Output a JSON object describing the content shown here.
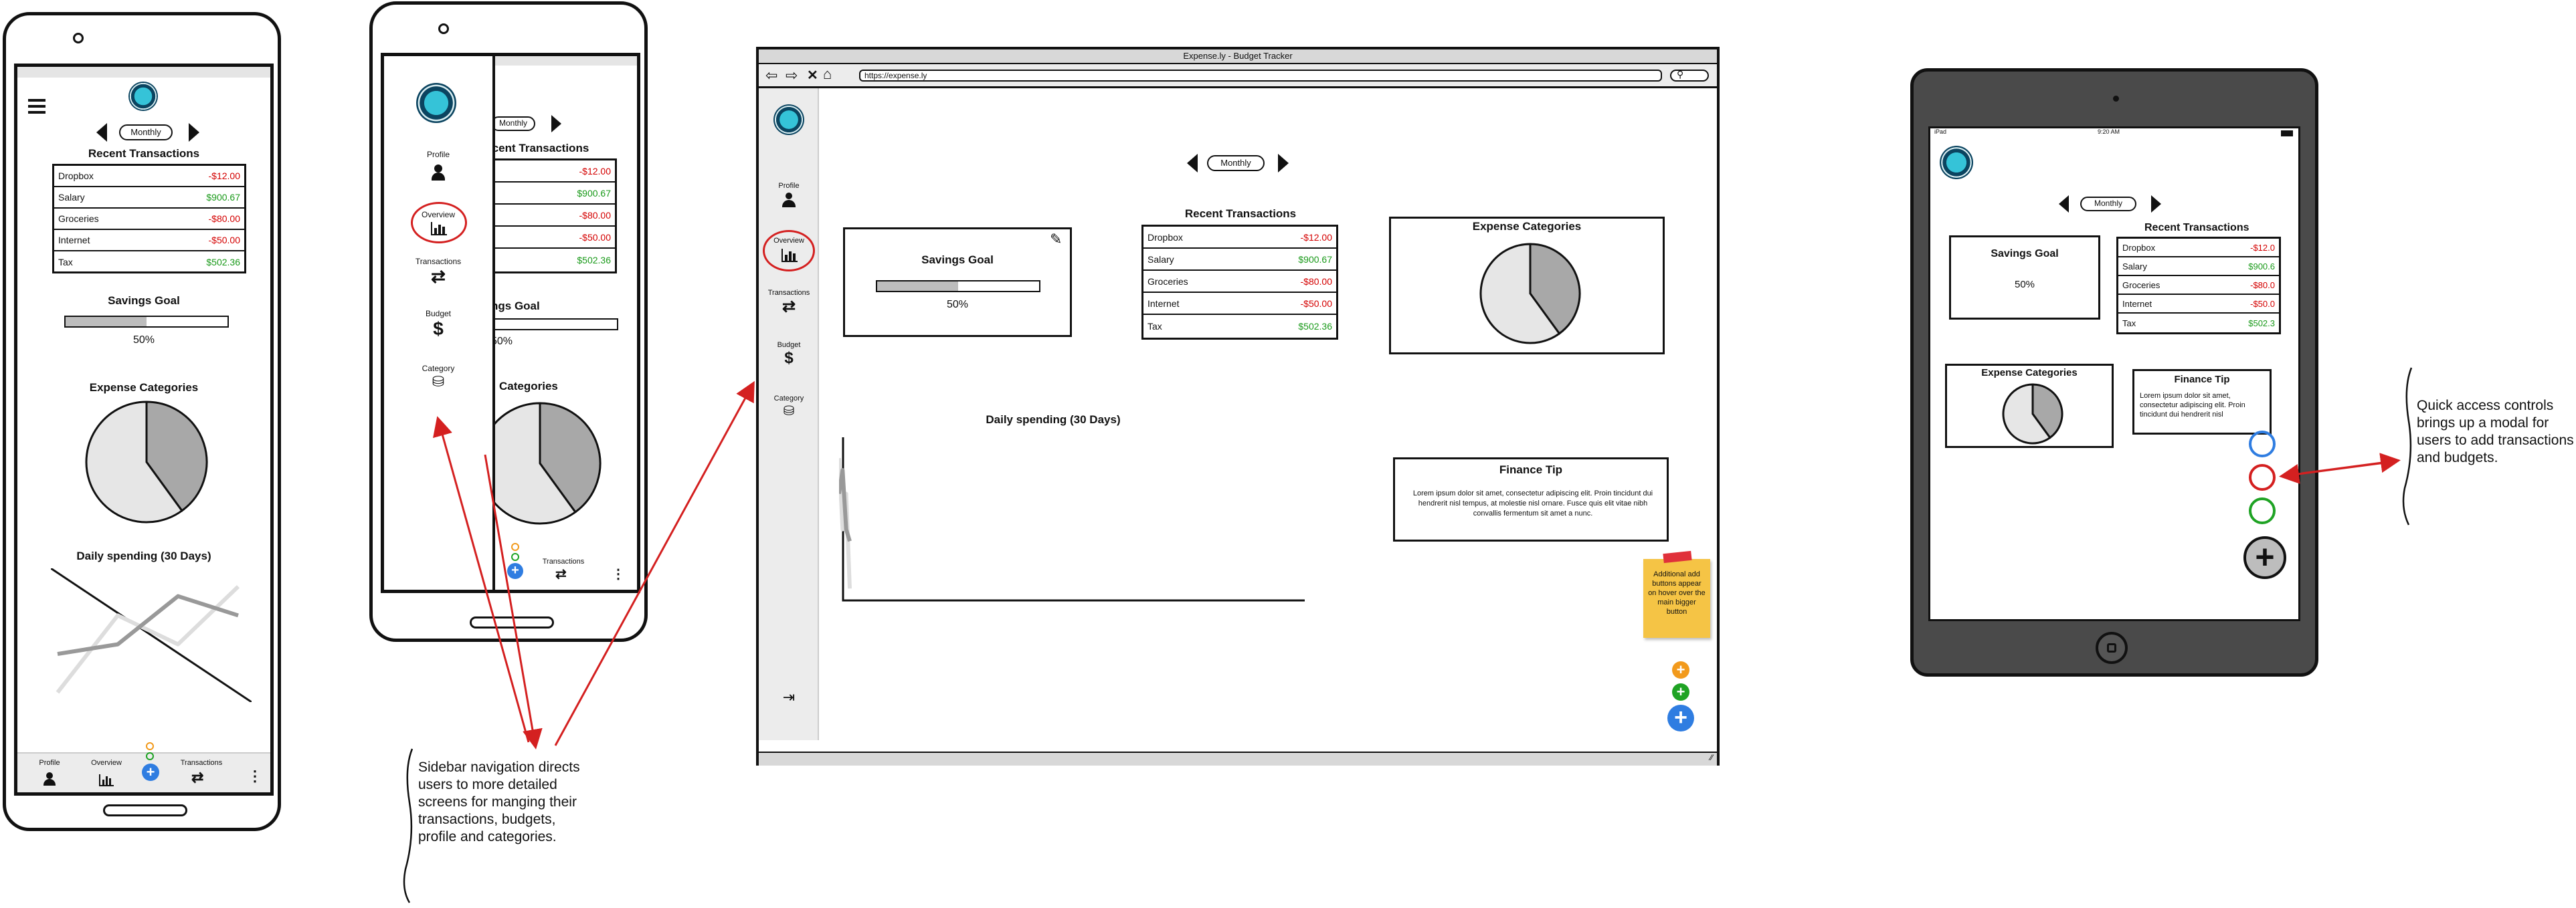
{
  "common": {
    "period": "Monthly",
    "recent_transactions_title": "Recent Transactions",
    "transactions": [
      {
        "name": "Dropbox",
        "amount": "-$12.00"
      },
      {
        "name": "Salary",
        "amount": "$900.67"
      },
      {
        "name": "Groceries",
        "amount": "-$80.00"
      },
      {
        "name": "Internet",
        "amount": "-$50.00"
      },
      {
        "name": "Tax",
        "amount": "$502.36"
      }
    ],
    "savings_goal_title": "Savings Goal",
    "savings_goal_value": "50%",
    "savings_goal_fraction": 0.5,
    "expense_categories_title": "Expense Categories",
    "daily_spending_title": "Daily spending (30 Days)",
    "finance_tip_title": "Finance Tip",
    "finance_tip_text": "Lorem ipsum dolor sit amet, consectetur adipiscing elit. Proin tincidunt dui hendrerit nisl tempus, at molestie nisl ornare. Fusce quis elit vitae nibh convallis fermentum sit amet a nunc."
  },
  "phone1": {
    "bottom_nav": {
      "profile": "Profile",
      "overview": "Overview",
      "transactions": "Transactions"
    }
  },
  "phone2": {
    "sidebar": {
      "profile": "Profile",
      "overview": "Overview",
      "transactions": "Transactions",
      "budget": "Budget",
      "category": "Category"
    },
    "bottom_nav": {
      "transactions": "Transactions"
    },
    "amounts": [
      "-$12.00",
      "$900.67",
      "-$80.00",
      "-$50.00",
      "$502.36"
    ],
    "savings_partial": "ngs Goal",
    "savings_value_partial": "50%",
    "categories_partial": "Categories"
  },
  "browser": {
    "window_title": "Expense.ly - Budget Tracker",
    "url": "https://expense.ly",
    "sidebar": {
      "profile": "Profile",
      "overview": "Overview",
      "transactions": "Transactions",
      "budget": "Budget",
      "category": "Category"
    },
    "sticky_note": "Additional add buttons appear on hover over the main bigger button"
  },
  "tablet": {
    "status_left": "iPad",
    "status_time": "9:20 AM",
    "amounts": [
      "-$12.0",
      "$900.6",
      "-$80.0",
      "-$50.0",
      "$502.3"
    ],
    "tip_text": "Lorem ipsum dolor sit amet, consectetur adipiscing elit. Proin tincidunt dui hendrerit nisl"
  },
  "annotations": {
    "sidebar_note": "Sidebar navigation directs users to more detailed screens for manging their transactions, budgets, profile and categories.",
    "quick_access_note": "Quick access controls brings up a modal for users to add transactions and budgets."
  },
  "colors": {
    "income": "#1a9a1a",
    "expense": "#d40000",
    "fab_blue": "#2f7de1",
    "fab_green": "#1fa324",
    "fab_orange": "#f29a1c",
    "sticky": "#f5c445",
    "annotation_red": "#d42020"
  },
  "chart_data": [
    {
      "type": "pie",
      "title": "Expense Categories",
      "values": [
        40,
        60
      ]
    },
    {
      "type": "line",
      "title": "Daily spending (30 Days)",
      "series": [
        {
          "values": [
            25,
            30,
            55,
            45
          ]
        },
        {
          "values": [
            5,
            45,
            30,
            60
          ]
        }
      ]
    }
  ]
}
